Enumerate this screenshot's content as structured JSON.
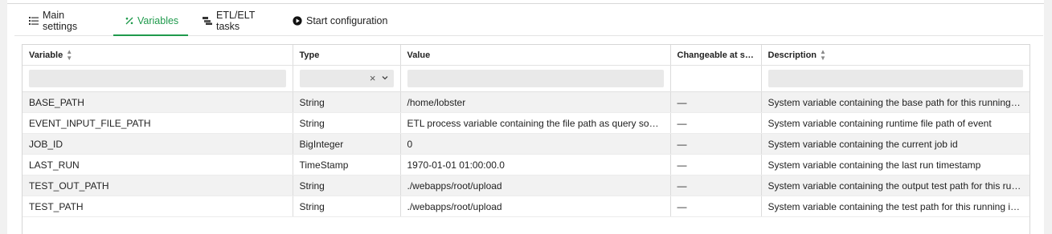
{
  "tabs": [
    {
      "label": "Main settings",
      "icon": "list-icon"
    },
    {
      "label": "Variables",
      "icon": "percent-icon"
    },
    {
      "label": "ETL/ELT tasks",
      "icon": "tasks-icon"
    },
    {
      "label": "Start configuration",
      "icon": "play-icon"
    }
  ],
  "active_tab": "Variables",
  "accent_color": "#1f9a4c",
  "table": {
    "columns": [
      "Variable",
      "Type",
      "Value",
      "Changeable at start",
      "Description"
    ],
    "rows": [
      {
        "variable": "BASE_PATH",
        "type": "String",
        "value": "/home/lobster",
        "changeable": "—",
        "description": "System variable containing the base path for this running in…"
      },
      {
        "variable": "EVENT_INPUT_FILE_PATH",
        "type": "String",
        "value": "ETL process variable containing the file path as query source",
        "changeable": "—",
        "description": "System variable containing runtime file path of event"
      },
      {
        "variable": "JOB_ID",
        "type": "BigInteger",
        "value": "0",
        "changeable": "—",
        "description": "System variable containing the current job id"
      },
      {
        "variable": "LAST_RUN",
        "type": "TimeStamp",
        "value": "1970-01-01 01:00:00.0",
        "changeable": "—",
        "description": "System variable containing the last run timestamp"
      },
      {
        "variable": "TEST_OUT_PATH",
        "type": "String",
        "value": "./webapps/root/upload",
        "changeable": "—",
        "description": "System variable containing the output test path for this runn…"
      },
      {
        "variable": "TEST_PATH",
        "type": "String",
        "value": "./webapps/root/upload",
        "changeable": "—",
        "description": "System variable containing the test path for this running ins…"
      }
    ]
  }
}
